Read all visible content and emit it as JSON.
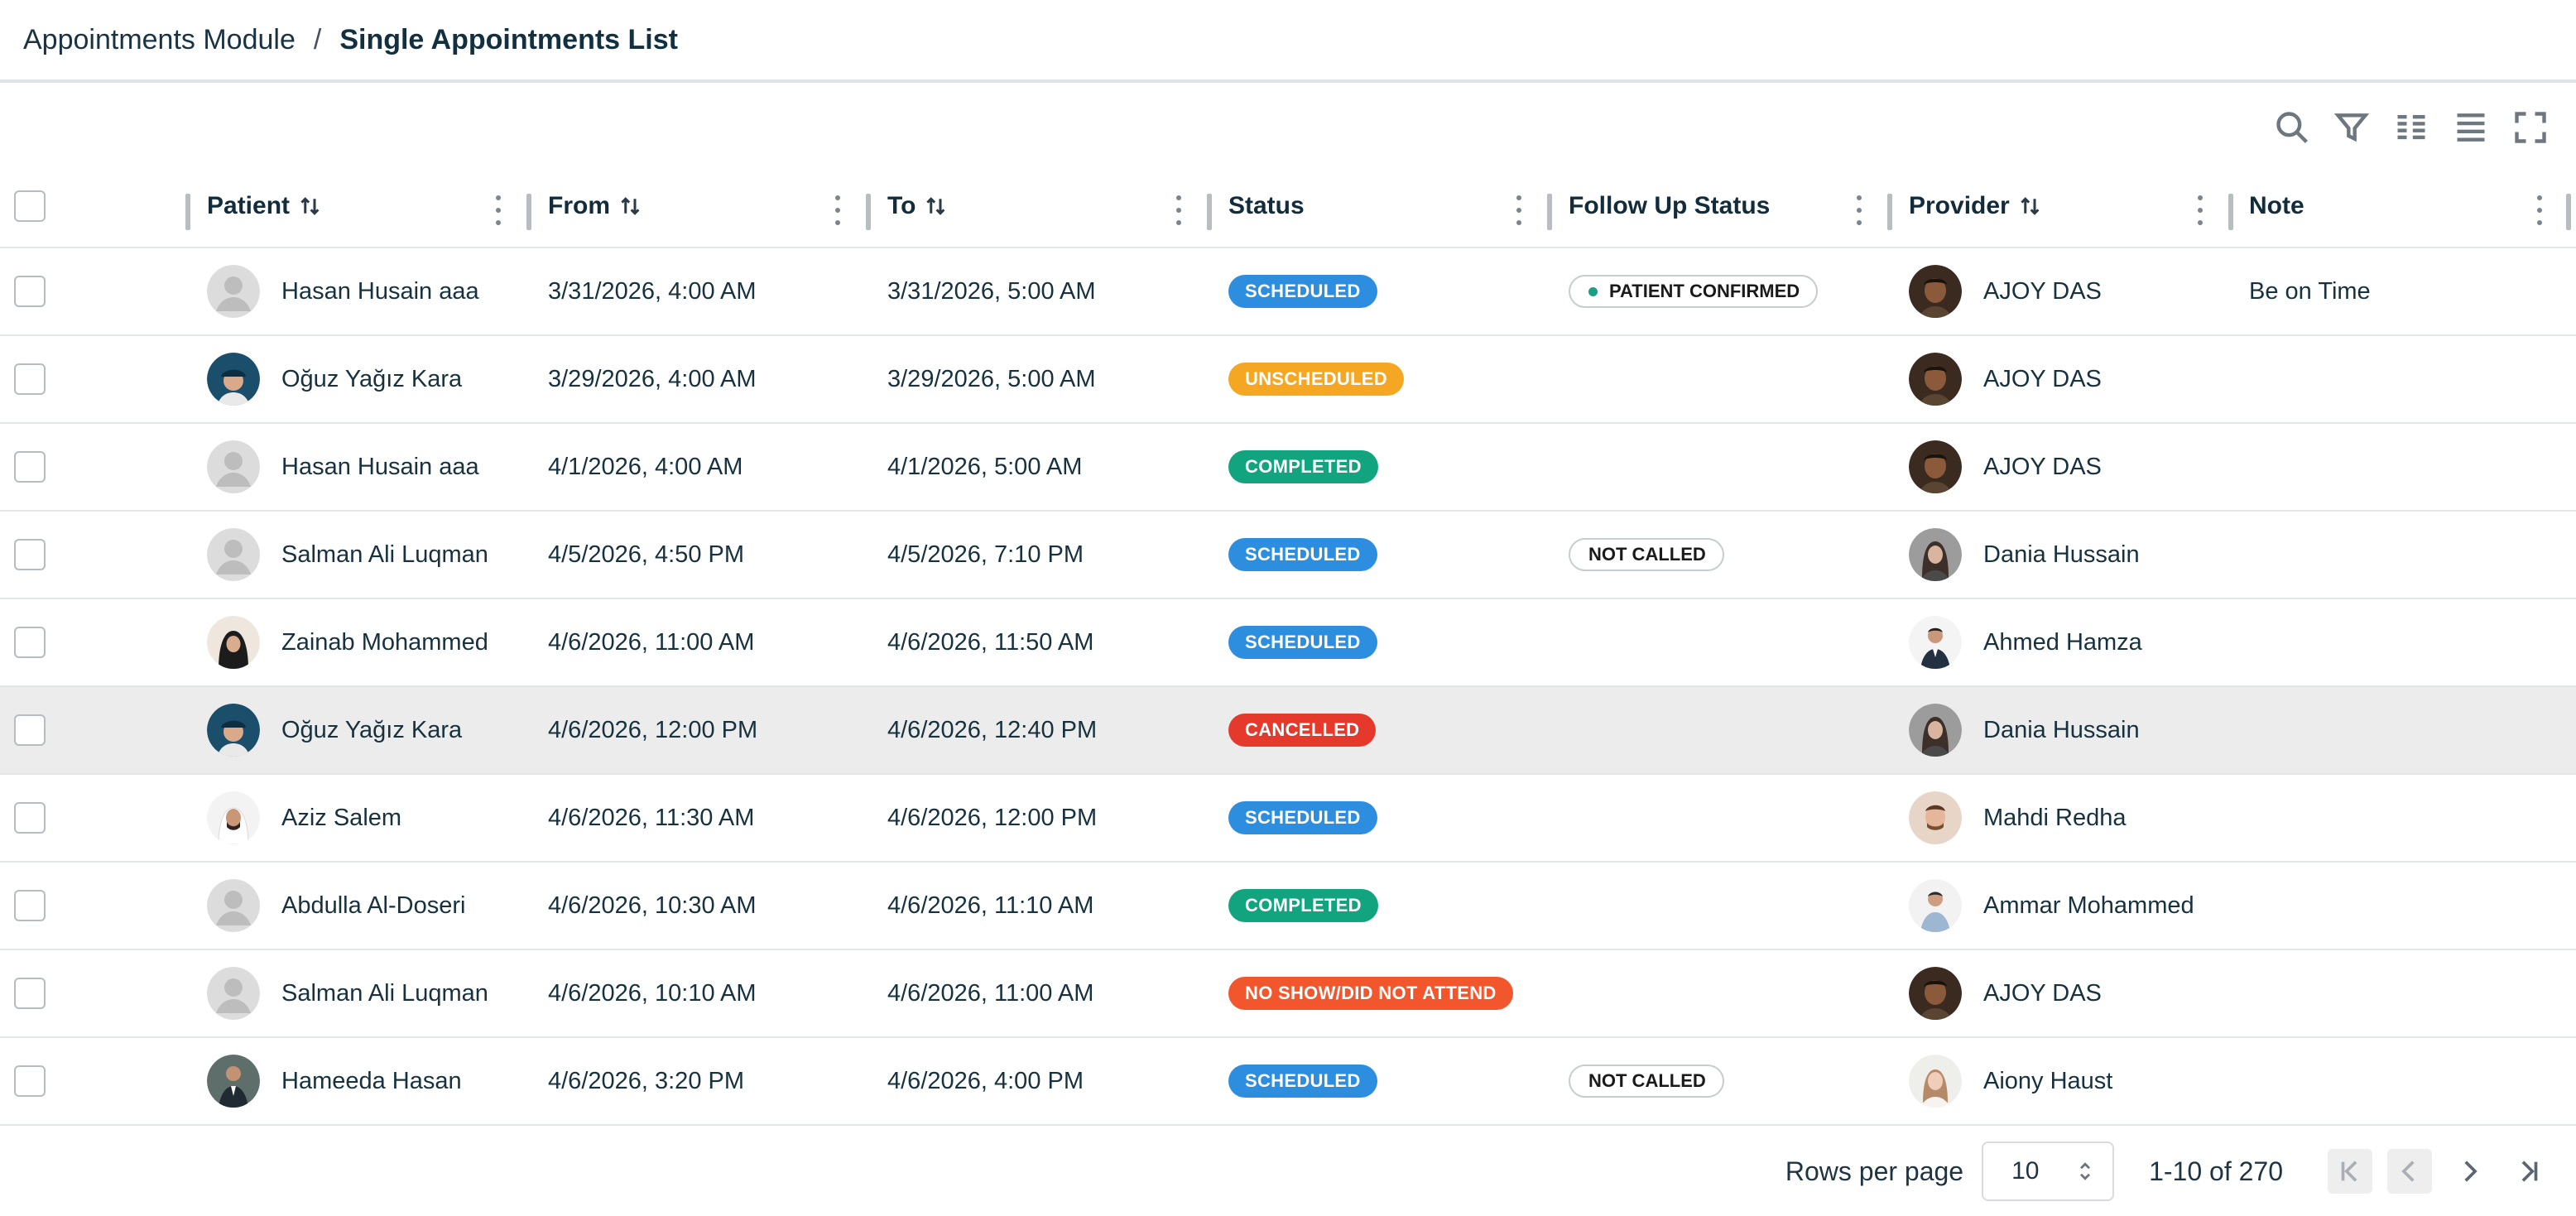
{
  "breadcrumb": {
    "parent": "Appointments Module",
    "separator": "/",
    "current": "Single Appointments List"
  },
  "toolbar": [
    "search-icon",
    "filter-icon",
    "columns-icon",
    "density-icon",
    "fullscreen-icon"
  ],
  "columns": {
    "patient": "Patient",
    "from": "From",
    "to": "To",
    "status": "Status",
    "follow_up": "Follow Up Status",
    "provider": "Provider",
    "note": "Note"
  },
  "status_colors": {
    "SCHEDULED": "#2d8ee0",
    "UNSCHEDULED": "#f5a623",
    "COMPLETED": "#12a37f",
    "CANCELLED": "#e5392b",
    "NO SHOW/DID NOT ATTEND": "#f2562c"
  },
  "rows": [
    {
      "patient": "Hasan Husain aaa",
      "patient_avatar": "placeholder",
      "from": "3/31/2026, 4:00 AM",
      "to": "3/31/2026, 5:00 AM",
      "status": "SCHEDULED",
      "follow_up": "PATIENT CONFIRMED",
      "follow_up_dot": "#16a085",
      "provider": "AJOY DAS",
      "provider_avatar": "dark",
      "note": "Be on Time",
      "highlight": false
    },
    {
      "patient": "Oğuz Yağız Kara",
      "patient_avatar": "cap",
      "from": "3/29/2026, 4:00 AM",
      "to": "3/29/2026, 5:00 AM",
      "status": "UNSCHEDULED",
      "follow_up": "",
      "follow_up_dot": "",
      "provider": "AJOY DAS",
      "provider_avatar": "dark",
      "note": "",
      "highlight": false
    },
    {
      "patient": "Hasan Husain aaa",
      "patient_avatar": "placeholder",
      "from": "4/1/2026, 4:00 AM",
      "to": "4/1/2026, 5:00 AM",
      "status": "COMPLETED",
      "follow_up": "",
      "follow_up_dot": "",
      "provider": "AJOY DAS",
      "provider_avatar": "dark",
      "note": "",
      "highlight": false
    },
    {
      "patient": "Salman Ali Luqman",
      "patient_avatar": "placeholder",
      "from": "4/5/2026, 4:50 PM",
      "to": "4/5/2026, 7:10 PM",
      "status": "SCHEDULED",
      "follow_up": "NOT CALLED",
      "follow_up_dot": "",
      "provider": "Dania Hussain",
      "provider_avatar": "woman",
      "note": "",
      "highlight": false
    },
    {
      "patient": "Zainab Mohammed",
      "patient_avatar": "hijab",
      "from": "4/6/2026, 11:00 AM",
      "to": "4/6/2026, 11:50 AM",
      "status": "SCHEDULED",
      "follow_up": "",
      "follow_up_dot": "",
      "provider": "Ahmed Hamza",
      "provider_avatar": "suit",
      "note": "",
      "highlight": false
    },
    {
      "patient": "Oğuz Yağız Kara",
      "patient_avatar": "cap",
      "from": "4/6/2026, 12:00 PM",
      "to": "4/6/2026, 12:40 PM",
      "status": "CANCELLED",
      "follow_up": "",
      "follow_up_dot": "",
      "provider": "Dania Hussain",
      "provider_avatar": "woman",
      "note": "",
      "highlight": true
    },
    {
      "patient": "Aziz Salem",
      "patient_avatar": "ghutra",
      "from": "4/6/2026, 11:30 AM",
      "to": "4/6/2026, 12:00 PM",
      "status": "SCHEDULED",
      "follow_up": "",
      "follow_up_dot": "",
      "provider": "Mahdi Redha",
      "provider_avatar": "light",
      "note": "",
      "highlight": false
    },
    {
      "patient": "Abdulla Al-Doseri",
      "patient_avatar": "placeholder",
      "from": "4/6/2026, 10:30 AM",
      "to": "4/6/2026, 11:10 AM",
      "status": "COMPLETED",
      "follow_up": "",
      "follow_up_dot": "",
      "provider": "Ammar Mohammed",
      "provider_avatar": "shirt",
      "note": "",
      "highlight": false
    },
    {
      "patient": "Salman Ali Luqman",
      "patient_avatar": "placeholder",
      "from": "4/6/2026, 10:10 AM",
      "to": "4/6/2026, 11:00 AM",
      "status": "NO SHOW/DID NOT ATTEND",
      "follow_up": "",
      "follow_up_dot": "",
      "provider": "AJOY DAS",
      "provider_avatar": "dark",
      "note": "",
      "highlight": false
    },
    {
      "patient": "Hameeda Hasan",
      "patient_avatar": "suitman",
      "from": "4/6/2026, 3:20 PM",
      "to": "4/6/2026, 4:00 PM",
      "status": "SCHEDULED",
      "follow_up": "NOT CALLED",
      "follow_up_dot": "",
      "provider": "Aiony Haust",
      "provider_avatar": "fair",
      "note": "",
      "highlight": false
    }
  ],
  "pagination": {
    "rows_per_page_label": "Rows per page",
    "rows_per_page": "10",
    "range": "1-10 of 270"
  }
}
